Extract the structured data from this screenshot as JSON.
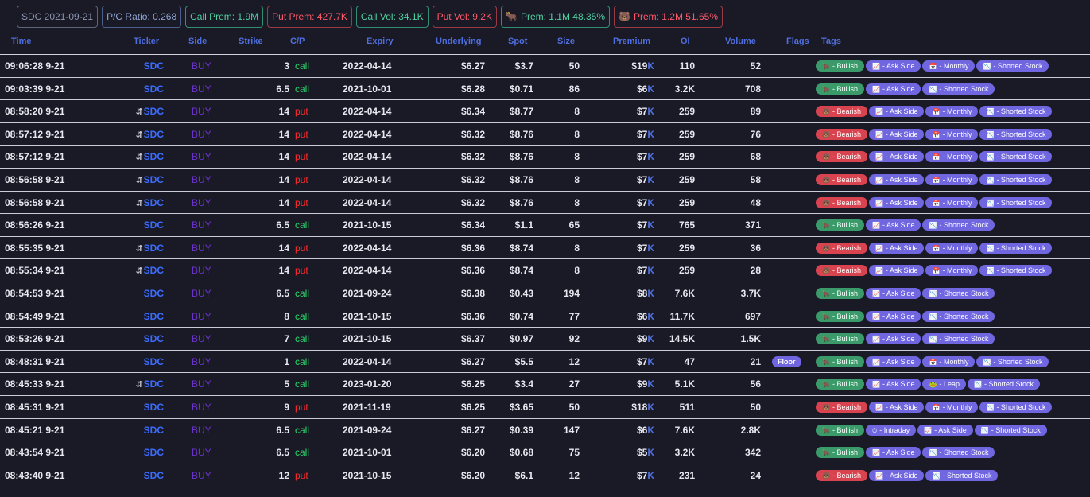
{
  "stats": [
    {
      "text": "SDC 2021-09-21",
      "tone": "gray",
      "icon": ""
    },
    {
      "text": "P/C Ratio: 0.268",
      "tone": "blue",
      "icon": ""
    },
    {
      "text": "Call Prem: 1.9M",
      "tone": "green",
      "icon": ""
    },
    {
      "text": "Put Prem: 427.7K",
      "tone": "red",
      "icon": ""
    },
    {
      "text": "Call Vol: 34.1K",
      "tone": "green",
      "icon": ""
    },
    {
      "text": "Put Vol: 9.2K",
      "tone": "red",
      "icon": ""
    },
    {
      "text": "Prem: 1.1M 48.35%",
      "tone": "green",
      "icon": "bull-icon"
    },
    {
      "text": "Prem: 1.2M 51.65%",
      "tone": "red",
      "icon": "bear-icon"
    }
  ],
  "headers": {
    "time": "Time",
    "ticker": "Ticker",
    "side": "Side",
    "strike": "Strike",
    "cp": "C/P",
    "expiry": "Expiry",
    "underlying": "Underlying",
    "spot": "Spot",
    "size": "Size",
    "premium": "Premium",
    "oi": "OI",
    "volume": "Volume",
    "flags": "Flags",
    "tags": "Tags"
  },
  "tag_labels": {
    "bullish": "- Bullish",
    "bearish": "- Bearish",
    "ask": "- Ask Side",
    "monthly": "- Monthly",
    "shorted": "- Shorted Stock",
    "leap": "- Leap",
    "intraday": "- Intraday"
  },
  "rows": [
    {
      "time": "09:06:28 9-21",
      "sweep": false,
      "ticker": "SDC",
      "side": "BUY",
      "strike": "3",
      "cp": "call",
      "expiry": "2022-04-14",
      "underlying": "$6.27",
      "spot": "$3.7",
      "size": "50",
      "premium": "$19",
      "oi": "110",
      "volume": "52",
      "flag": "",
      "tags": [
        "bullish",
        "ask",
        "monthly",
        "shorted"
      ]
    },
    {
      "time": "09:03:39 9-21",
      "sweep": false,
      "ticker": "SDC",
      "side": "BUY",
      "strike": "6.5",
      "cp": "call",
      "expiry": "2021-10-01",
      "underlying": "$6.28",
      "spot": "$0.71",
      "size": "86",
      "premium": "$6",
      "oi": "3.2K",
      "volume": "708",
      "flag": "",
      "tags": [
        "bullish",
        "ask",
        "shorted"
      ]
    },
    {
      "time": "08:58:20 9-21",
      "sweep": true,
      "ticker": "SDC",
      "side": "BUY",
      "strike": "14",
      "cp": "put",
      "expiry": "2022-04-14",
      "underlying": "$6.34",
      "spot": "$8.77",
      "size": "8",
      "premium": "$7",
      "oi": "259",
      "volume": "89",
      "flag": "",
      "tags": [
        "bearish",
        "ask",
        "monthly",
        "shorted"
      ]
    },
    {
      "time": "08:57:12 9-21",
      "sweep": true,
      "ticker": "SDC",
      "side": "BUY",
      "strike": "14",
      "cp": "put",
      "expiry": "2022-04-14",
      "underlying": "$6.32",
      "spot": "$8.76",
      "size": "8",
      "premium": "$7",
      "oi": "259",
      "volume": "76",
      "flag": "",
      "tags": [
        "bearish",
        "ask",
        "monthly",
        "shorted"
      ]
    },
    {
      "time": "08:57:12 9-21",
      "sweep": true,
      "ticker": "SDC",
      "side": "BUY",
      "strike": "14",
      "cp": "put",
      "expiry": "2022-04-14",
      "underlying": "$6.32",
      "spot": "$8.76",
      "size": "8",
      "premium": "$7",
      "oi": "259",
      "volume": "68",
      "flag": "",
      "tags": [
        "bearish",
        "ask",
        "monthly",
        "shorted"
      ]
    },
    {
      "time": "08:56:58 9-21",
      "sweep": true,
      "ticker": "SDC",
      "side": "BUY",
      "strike": "14",
      "cp": "put",
      "expiry": "2022-04-14",
      "underlying": "$6.32",
      "spot": "$8.76",
      "size": "8",
      "premium": "$7",
      "oi": "259",
      "volume": "58",
      "flag": "",
      "tags": [
        "bearish",
        "ask",
        "monthly",
        "shorted"
      ]
    },
    {
      "time": "08:56:58 9-21",
      "sweep": true,
      "ticker": "SDC",
      "side": "BUY",
      "strike": "14",
      "cp": "put",
      "expiry": "2022-04-14",
      "underlying": "$6.32",
      "spot": "$8.76",
      "size": "8",
      "premium": "$7",
      "oi": "259",
      "volume": "48",
      "flag": "",
      "tags": [
        "bearish",
        "ask",
        "monthly",
        "shorted"
      ]
    },
    {
      "time": "08:56:26 9-21",
      "sweep": false,
      "ticker": "SDC",
      "side": "BUY",
      "strike": "6.5",
      "cp": "call",
      "expiry": "2021-10-15",
      "underlying": "$6.34",
      "spot": "$1.1",
      "size": "65",
      "premium": "$7",
      "oi": "765",
      "volume": "371",
      "flag": "",
      "tags": [
        "bullish",
        "ask",
        "shorted"
      ]
    },
    {
      "time": "08:55:35 9-21",
      "sweep": true,
      "ticker": "SDC",
      "side": "BUY",
      "strike": "14",
      "cp": "put",
      "expiry": "2022-04-14",
      "underlying": "$6.36",
      "spot": "$8.74",
      "size": "8",
      "premium": "$7",
      "oi": "259",
      "volume": "36",
      "flag": "",
      "tags": [
        "bearish",
        "ask",
        "monthly",
        "shorted"
      ]
    },
    {
      "time": "08:55:34 9-21",
      "sweep": true,
      "ticker": "SDC",
      "side": "BUY",
      "strike": "14",
      "cp": "put",
      "expiry": "2022-04-14",
      "underlying": "$6.36",
      "spot": "$8.74",
      "size": "8",
      "premium": "$7",
      "oi": "259",
      "volume": "28",
      "flag": "",
      "tags": [
        "bearish",
        "ask",
        "monthly",
        "shorted"
      ]
    },
    {
      "time": "08:54:53 9-21",
      "sweep": false,
      "ticker": "SDC",
      "side": "BUY",
      "strike": "6.5",
      "cp": "call",
      "expiry": "2021-09-24",
      "underlying": "$6.38",
      "spot": "$0.43",
      "size": "194",
      "premium": "$8",
      "oi": "7.6K",
      "volume": "3.7K",
      "flag": "",
      "tags": [
        "bullish",
        "ask",
        "shorted"
      ]
    },
    {
      "time": "08:54:49 9-21",
      "sweep": false,
      "ticker": "SDC",
      "side": "BUY",
      "strike": "8",
      "cp": "call",
      "expiry": "2021-10-15",
      "underlying": "$6.36",
      "spot": "$0.74",
      "size": "77",
      "premium": "$6",
      "oi": "11.7K",
      "volume": "697",
      "flag": "",
      "tags": [
        "bullish",
        "ask",
        "shorted"
      ]
    },
    {
      "time": "08:53:26 9-21",
      "sweep": false,
      "ticker": "SDC",
      "side": "BUY",
      "strike": "7",
      "cp": "call",
      "expiry": "2021-10-15",
      "underlying": "$6.37",
      "spot": "$0.97",
      "size": "92",
      "premium": "$9",
      "oi": "14.5K",
      "volume": "1.5K",
      "flag": "",
      "tags": [
        "bullish",
        "ask",
        "shorted"
      ]
    },
    {
      "time": "08:48:31 9-21",
      "sweep": false,
      "ticker": "SDC",
      "side": "BUY",
      "strike": "1",
      "cp": "call",
      "expiry": "2022-04-14",
      "underlying": "$6.27",
      "spot": "$5.5",
      "size": "12",
      "premium": "$7",
      "oi": "47",
      "volume": "21",
      "flag": "Floor",
      "tags": [
        "bullish",
        "ask",
        "monthly",
        "shorted"
      ]
    },
    {
      "time": "08:45:33 9-21",
      "sweep": true,
      "ticker": "SDC",
      "side": "BUY",
      "strike": "5",
      "cp": "call",
      "expiry": "2023-01-20",
      "underlying": "$6.25",
      "spot": "$3.4",
      "size": "27",
      "premium": "$9",
      "oi": "5.1K",
      "volume": "56",
      "flag": "",
      "tags": [
        "bullish",
        "ask",
        "leap",
        "shorted"
      ]
    },
    {
      "time": "08:45:31 9-21",
      "sweep": false,
      "ticker": "SDC",
      "side": "BUY",
      "strike": "9",
      "cp": "put",
      "expiry": "2021-11-19",
      "underlying": "$6.25",
      "spot": "$3.65",
      "size": "50",
      "premium": "$18",
      "oi": "511",
      "volume": "50",
      "flag": "",
      "tags": [
        "bearish",
        "ask",
        "monthly",
        "shorted"
      ]
    },
    {
      "time": "08:45:21 9-21",
      "sweep": false,
      "ticker": "SDC",
      "side": "BUY",
      "strike": "6.5",
      "cp": "call",
      "expiry": "2021-09-24",
      "underlying": "$6.27",
      "spot": "$0.39",
      "size": "147",
      "premium": "$6",
      "oi": "7.6K",
      "volume": "2.8K",
      "flag": "",
      "tags": [
        "bullish",
        "intraday",
        "ask",
        "shorted"
      ]
    },
    {
      "time": "08:43:54 9-21",
      "sweep": false,
      "ticker": "SDC",
      "side": "BUY",
      "strike": "6.5",
      "cp": "call",
      "expiry": "2021-10-01",
      "underlying": "$6.20",
      "spot": "$0.68",
      "size": "75",
      "premium": "$5",
      "oi": "3.2K",
      "volume": "342",
      "flag": "",
      "tags": [
        "bullish",
        "ask",
        "shorted"
      ]
    },
    {
      "time": "08:43:40 9-21",
      "sweep": false,
      "ticker": "SDC",
      "side": "BUY",
      "strike": "12",
      "cp": "put",
      "expiry": "2021-10-15",
      "underlying": "$6.20",
      "spot": "$6.1",
      "size": "12",
      "premium": "$7",
      "oi": "231",
      "volume": "24",
      "flag": "",
      "tags": [
        "bearish",
        "ask",
        "shorted"
      ]
    }
  ],
  "premium_suffix": "K",
  "sweep_glyph": "⇵"
}
